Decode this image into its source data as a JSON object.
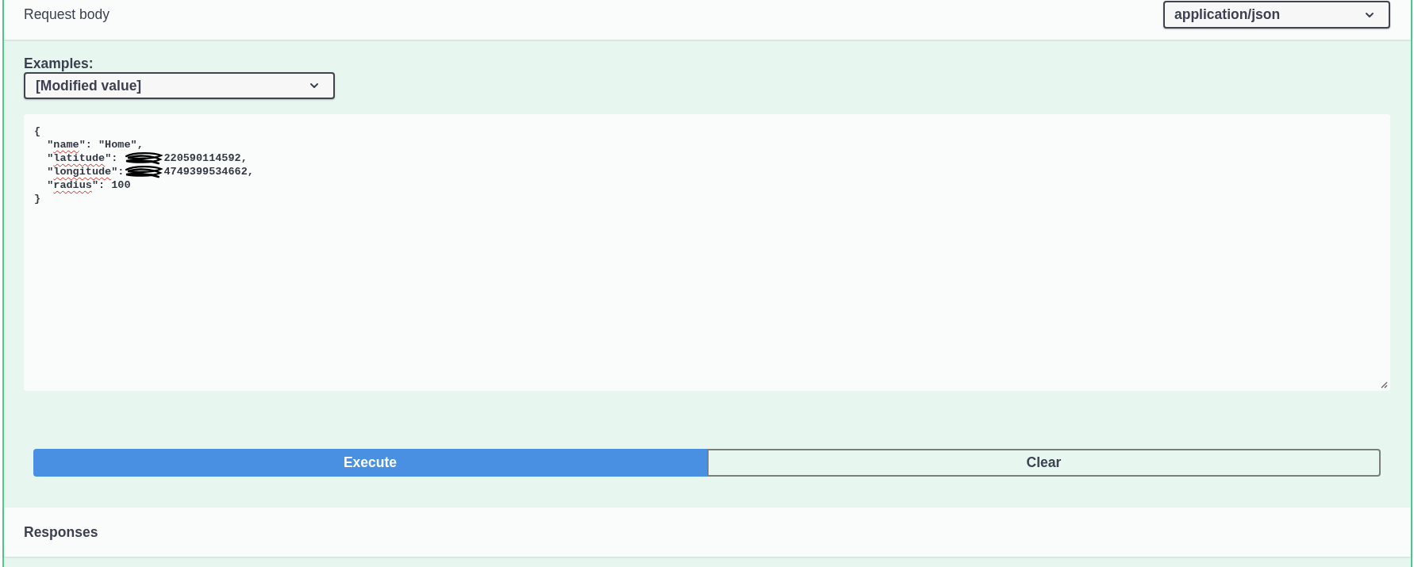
{
  "request_body": {
    "title": "Request body",
    "content_type": "application/json"
  },
  "examples": {
    "label": "Examples:",
    "selected_value": "[Modified value]"
  },
  "editor": {
    "lines": [
      {
        "parts": [
          {
            "kind": "plain",
            "text": "{"
          }
        ]
      },
      {
        "parts": [
          {
            "kind": "plain",
            "text": "  \""
          },
          {
            "kind": "flagged",
            "text": "name"
          },
          {
            "kind": "plain",
            "text": "\": \"Home\","
          }
        ]
      },
      {
        "parts": [
          {
            "kind": "plain",
            "text": "  \""
          },
          {
            "kind": "flagged",
            "text": "latitude"
          },
          {
            "kind": "plain",
            "text": "\": "
          },
          {
            "kind": "redacted"
          },
          {
            "kind": "plain",
            "text": "220590114592,"
          }
        ]
      },
      {
        "parts": [
          {
            "kind": "plain",
            "text": "  \""
          },
          {
            "kind": "flagged",
            "text": "longitude"
          },
          {
            "kind": "plain",
            "text": "\":"
          },
          {
            "kind": "redacted"
          },
          {
            "kind": "plain",
            "text": "4749399534662,"
          }
        ]
      },
      {
        "parts": [
          {
            "kind": "plain",
            "text": "  \""
          },
          {
            "kind": "flagged",
            "text": "radius"
          },
          {
            "kind": "plain",
            "text": "\": 100"
          }
        ]
      },
      {
        "parts": [
          {
            "kind": "plain",
            "text": "}"
          }
        ]
      }
    ]
  },
  "buttons": [
    {
      "label": "Execute",
      "kind": "primary"
    },
    {
      "label": "Clear",
      "kind": "secondary"
    }
  ],
  "responses": {
    "title": "Responses"
  }
}
